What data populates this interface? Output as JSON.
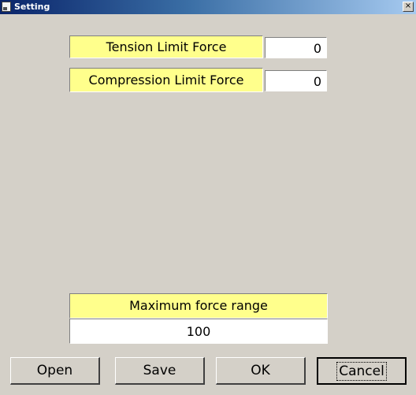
{
  "window": {
    "title": "Setting",
    "close_glyph": "×",
    "icon": "window-app-icon"
  },
  "fields": {
    "tension": {
      "label": "Tension Limit Force",
      "value": "0"
    },
    "compression": {
      "label": "Compression Limit Force",
      "value": "0"
    },
    "max_range": {
      "label": "Maximum force range",
      "value": "100"
    }
  },
  "buttons": {
    "open": "Open",
    "save": "Save",
    "ok": "OK",
    "cancel": "Cancel"
  },
  "colors": {
    "background": "#d4d0c8",
    "label_fill": "#ffff8c",
    "title_bar_start": "#0a246a",
    "title_bar_end": "#a6caf0"
  }
}
